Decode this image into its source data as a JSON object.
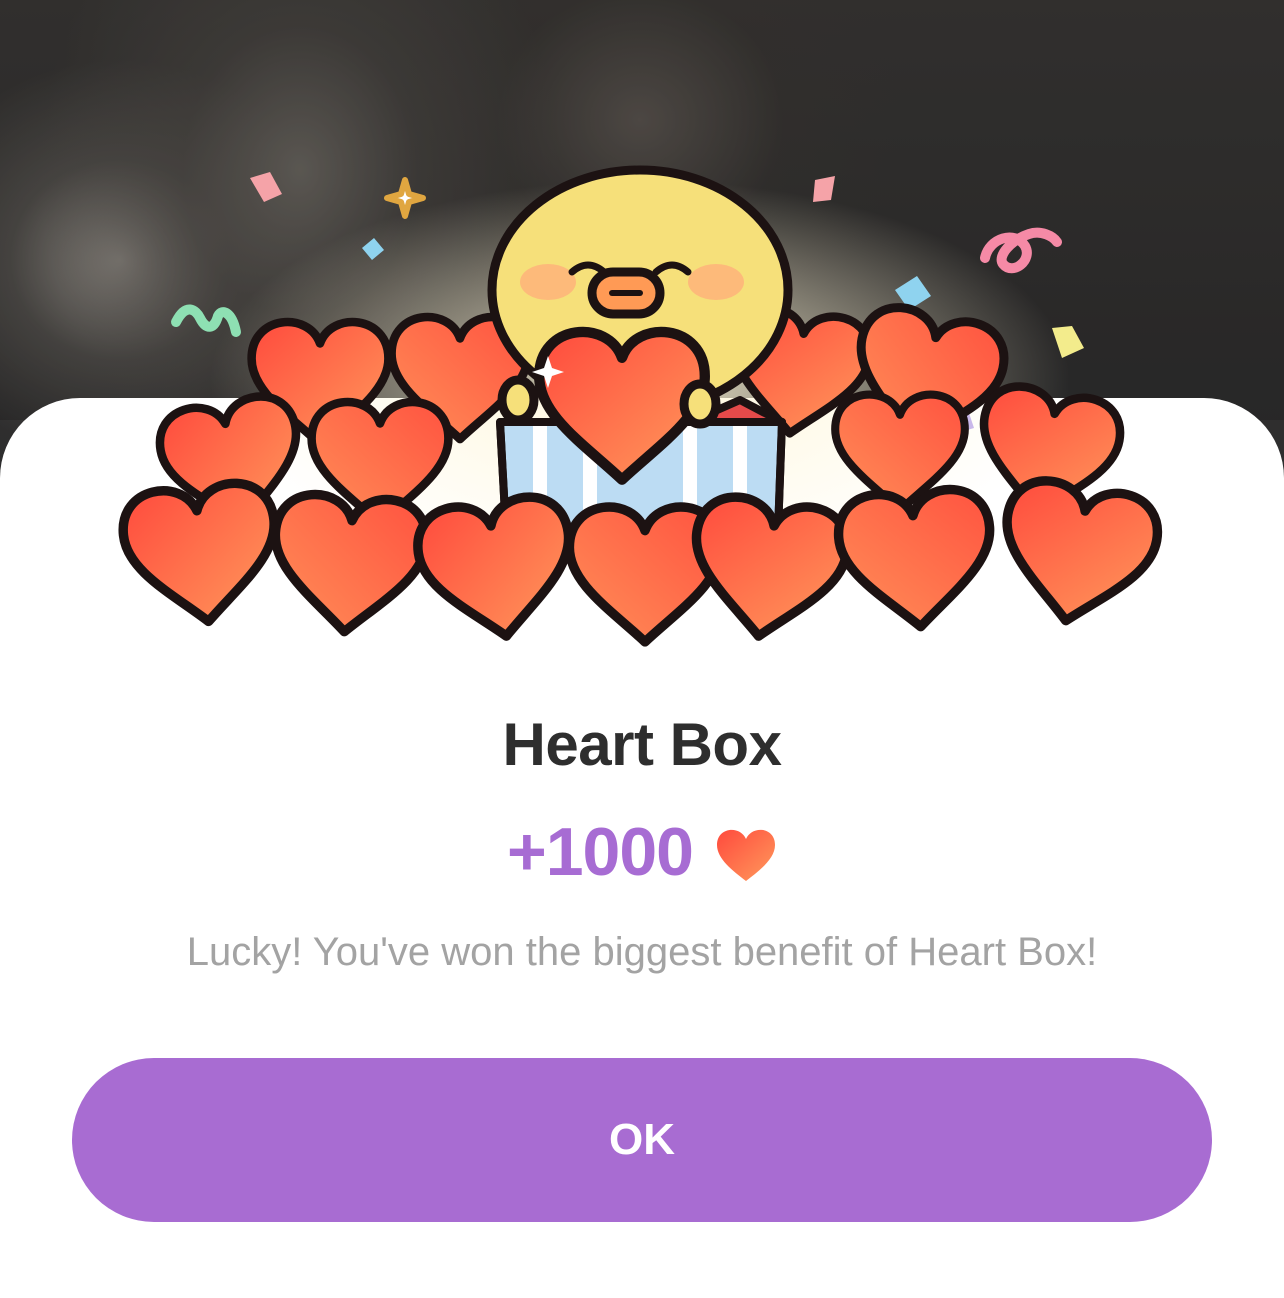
{
  "dialog": {
    "title": "Heart Box",
    "amount": "+1000",
    "message": "Lucky! You've won the biggest benefit of Heart Box!",
    "ok_label": "OK"
  },
  "icons": {
    "reward_icon": "heart-icon",
    "illustration": "duck-holding-heart-icon"
  },
  "colors": {
    "accent": "#a86cd2",
    "amount": "#a76cd3",
    "heart_start": "#ff4a3d",
    "heart_end": "#ff9a5c",
    "title": "#2e2e2e",
    "message": "#a3a3a3"
  }
}
